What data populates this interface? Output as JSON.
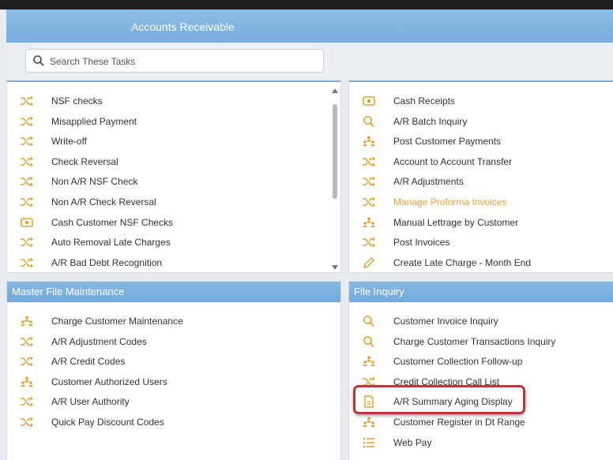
{
  "header": {
    "title": "Accounts Receivable"
  },
  "search": {
    "placeholder": "Search These Tasks"
  },
  "panel_left_top": {
    "items": [
      {
        "label": "NSF checks",
        "icon": "shuffle-icon"
      },
      {
        "label": "Misapplied Payment",
        "icon": "shuffle-icon"
      },
      {
        "label": "Write-off",
        "icon": "shuffle-icon"
      },
      {
        "label": "Check Reversal",
        "icon": "shuffle-icon"
      },
      {
        "label": "Non A/R NSF Check",
        "icon": "shuffle-icon"
      },
      {
        "label": "Non A/R Check Reversal",
        "icon": "shuffle-icon"
      },
      {
        "label": "Cash Customer NSF Checks",
        "icon": "cash-icon"
      },
      {
        "label": "Auto Removal Late Charges",
        "icon": "shuffle-icon"
      },
      {
        "label": "A/R Bad Debt Recognition",
        "icon": "shuffle-icon"
      }
    ]
  },
  "panel_right_top": {
    "items": [
      {
        "label": "Cash Receipts",
        "icon": "cash-icon"
      },
      {
        "label": "A/R Batch Inquiry",
        "icon": "search-icon"
      },
      {
        "label": "Post Customer Payments",
        "icon": "users-icon"
      },
      {
        "label": "Account to Account Transfer",
        "icon": "shuffle-icon"
      },
      {
        "label": "A/R Adjustments",
        "icon": "shuffle-icon"
      },
      {
        "label": "Manage Proforma Invoices",
        "icon": "shuffle-icon"
      },
      {
        "label": "Manual Lettrage by Customer",
        "icon": "users-icon"
      },
      {
        "label": "Post Invoices",
        "icon": "shuffle-icon"
      },
      {
        "label": "Create Late Charge - Month End",
        "icon": "pencil-icon"
      }
    ]
  },
  "panel_master": {
    "title": "Master File Maintenance",
    "items": [
      {
        "label": "Charge Customer Maintenance",
        "icon": "users-icon"
      },
      {
        "label": "A/R Adjustment Codes",
        "icon": "shuffle-icon"
      },
      {
        "label": "A/R Credit Codes",
        "icon": "shuffle-icon"
      },
      {
        "label": "Customer Authorized Users",
        "icon": "users-icon"
      },
      {
        "label": "A/R User Authority",
        "icon": "shuffle-icon"
      },
      {
        "label": "Quick Pay Discount Codes",
        "icon": "shuffle-icon"
      }
    ]
  },
  "panel_inquiry": {
    "title": "File Inquiry",
    "items": [
      {
        "label": "Customer Invoice Inquiry",
        "icon": "search-icon"
      },
      {
        "label": "Charge Customer Transactions Inquiry",
        "icon": "search-icon"
      },
      {
        "label": "Customer Collection Follow-up",
        "icon": "users-icon"
      },
      {
        "label": "Credit Collection Call List",
        "icon": "shuffle-icon"
      },
      {
        "label": "A/R Summary Aging Display",
        "icon": "document-icon"
      },
      {
        "label": "Customer Register in Dt Range",
        "icon": "users-icon"
      },
      {
        "label": "Web Pay",
        "icon": "list-icon"
      }
    ]
  },
  "colors": {
    "accent": "#7aaedc",
    "icon": "#e0a33a",
    "highlight": "#b73a3a"
  }
}
